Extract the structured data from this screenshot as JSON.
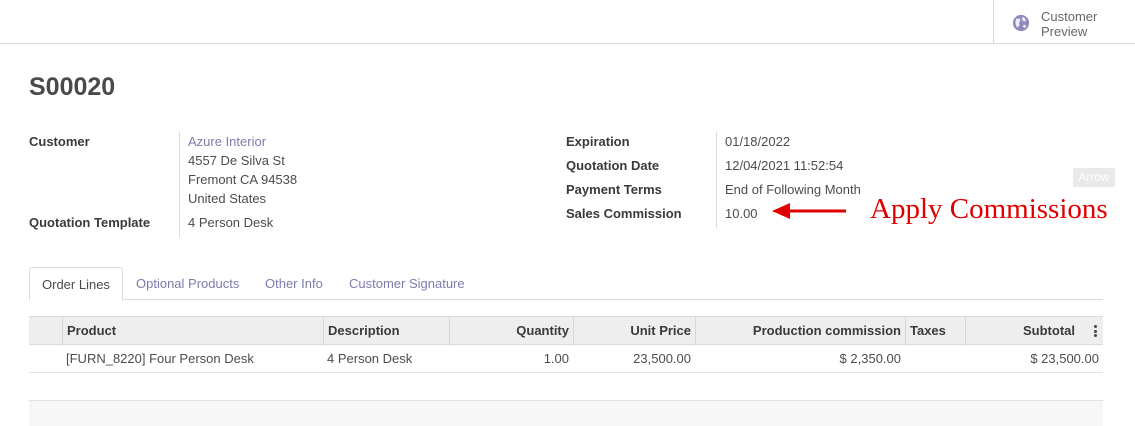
{
  "topbar": {
    "customer_preview_label": "Customer\nPreview",
    "customer_preview_icon": "globe-icon"
  },
  "record": {
    "title": "S00020"
  },
  "left_fields": {
    "customer_label": "Customer",
    "customer_name": "Azure Interior",
    "address_line1": "4557 De Silva St",
    "address_line2": "Fremont CA 94538",
    "address_line3": "United States",
    "quotation_template_label": "Quotation Template",
    "quotation_template_value": "4 Person Desk"
  },
  "right_fields": {
    "expiration_label": "Expiration",
    "expiration_value": "01/18/2022",
    "quotation_date_label": "Quotation Date",
    "quotation_date_value": "12/04/2021 11:52:54",
    "payment_terms_label": "Payment Terms",
    "payment_terms_value": "End of Following Month",
    "sales_commission_label": "Sales Commission",
    "sales_commission_value": "10.00"
  },
  "annotation": {
    "arrow_tag": "Arrow",
    "text": "Apply Commissions",
    "color": "#e00000"
  },
  "tabs": [
    "Order Lines",
    "Optional Products",
    "Other Info",
    "Customer Signature"
  ],
  "table": {
    "headers": {
      "product": "Product",
      "description": "Description",
      "quantity": "Quantity",
      "unit_price": "Unit Price",
      "production_commission": "Production commission",
      "taxes": "Taxes",
      "subtotal": "Subtotal"
    },
    "rows": [
      {
        "product": "[FURN_8220] Four Person Desk",
        "description": "4 Person Desk",
        "quantity": "1.00",
        "unit_price": "23,500.00",
        "production_commission": "$ 2,350.00",
        "taxes": "",
        "subtotal": "$ 23,500.00"
      }
    ]
  },
  "colors": {
    "link": "#7c7bad",
    "accent_icon": "#8f8bbf",
    "annotation": "#e00000"
  }
}
